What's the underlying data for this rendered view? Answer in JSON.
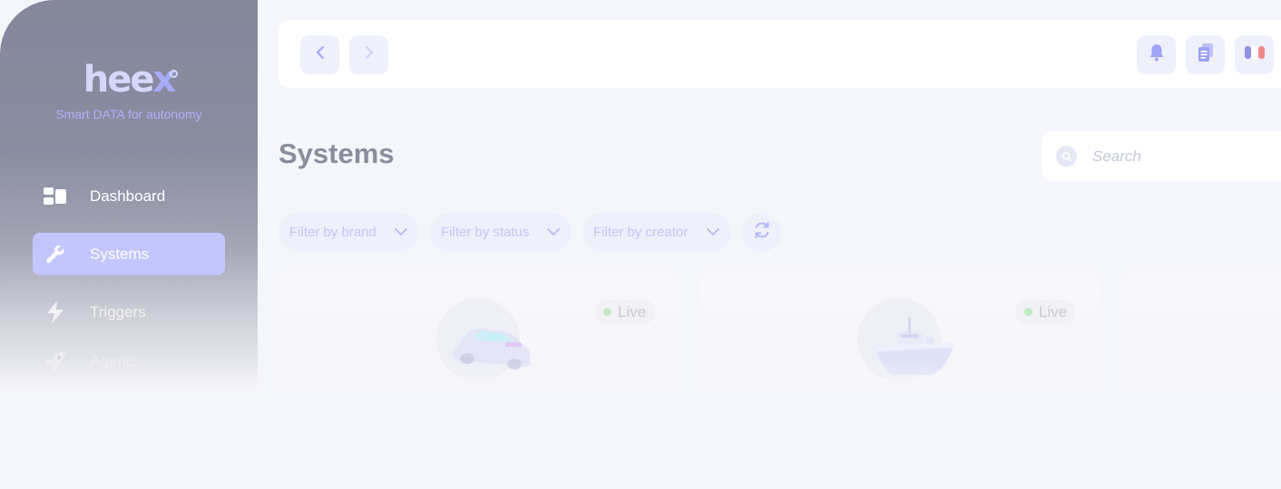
{
  "brand": {
    "name_main": "hee",
    "name_accent": "x",
    "tagline": "Smart DATA for autonomy"
  },
  "sidebar": {
    "items": [
      {
        "label": "Dashboard",
        "icon": "dashboard-icon",
        "active": false
      },
      {
        "label": "Systems",
        "icon": "wrench-icon",
        "active": true
      },
      {
        "label": "Triggers",
        "icon": "lightning-icon",
        "active": false
      },
      {
        "label": "Agents",
        "icon": "rocket-icon",
        "active": false
      }
    ]
  },
  "topbar": {
    "back_icon": "chevron-left-icon",
    "forward_icon": "chevron-right-icon",
    "notification_icon": "bell-icon",
    "docs_icon": "documents-icon",
    "language_icon": "france-flag-icon"
  },
  "page": {
    "title": "Systems",
    "search_placeholder": "Search"
  },
  "filters": [
    {
      "label": "Filter by brand"
    },
    {
      "label": "Filter by status"
    },
    {
      "label": "Filter by creator"
    }
  ],
  "cards": [
    {
      "status": "Live",
      "image": "car-icon"
    },
    {
      "status": "Live",
      "image": "boat-icon"
    },
    {
      "status": "",
      "image": ""
    }
  ],
  "colors": {
    "accent": "#a7abf8",
    "active_nav": "#c3c6fc",
    "status_live": "#bfeac4"
  }
}
